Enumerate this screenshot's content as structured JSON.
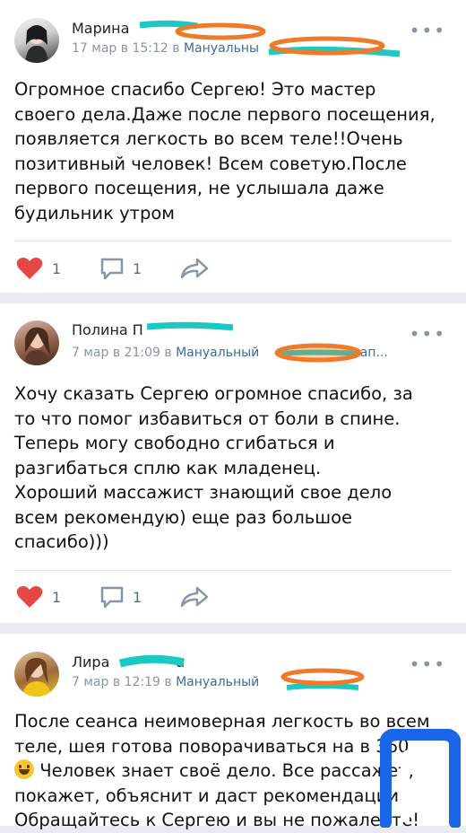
{
  "posts": [
    {
      "author": "Марина",
      "date": "17 мар в 15:12",
      "in": "в",
      "group": "Мануальны",
      "text": "Огромное спасибо Сергею! Это мастер\nсвоего дела.Даже после первого посещения,\nпоявляется легкость во всем теле!!Очень\nпозитивный человек! Всем советую.После\nпервого посещения, не услышала даже\nбудильник утром",
      "likes": "1",
      "comments": "1"
    },
    {
      "author": "Полина П",
      "date": "7 мар в 21:09",
      "in": "в",
      "group": "Мануальный",
      "group_tail": "ап...",
      "text": "Хочу сказать Сергею огромное спасибо, за\nто что помог избавиться от боли в спине.\nТеперь могу свободно сгибаться и\nразгибаться сплю как младенец.\nХороший массажист знающий свое дело\nвсем рекомендую) еще раз большое\nспасибо)))",
      "likes": "1",
      "comments": "1"
    },
    {
      "author": "Лира",
      "author_tail": "а",
      "date": "7 мар в 12:19",
      "in": "в",
      "group": "Мануальный",
      "text_line1": "После сеанса неимоверная легкость во всем",
      "text_line2": "теле, шея готова поворачиваться на в  360",
      "text_line3": "Человек знает своё дело. Все рассажет,",
      "text_line4": "покажет, объяснит и даст рекомендации!",
      "text_line5": "Обращайтесь к Сергею и вы не пожалеете!"
    }
  ],
  "more_glyph": "•••",
  "colors": {
    "like": "#e64646",
    "icon": "#8796a8",
    "link": "#3f6b9a",
    "scribble_orange": "#f07a2a",
    "scribble_teal": "#19c9c2",
    "logo_blue": "#1a66e8"
  },
  "icons": [
    "heart-icon",
    "comment-icon",
    "share-icon",
    "more-icon"
  ]
}
